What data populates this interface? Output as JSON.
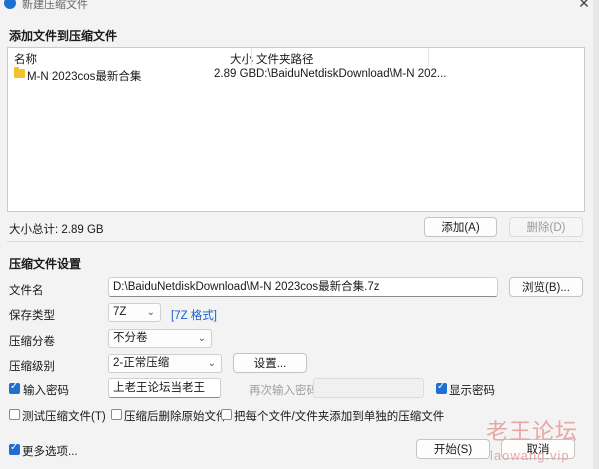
{
  "window": {
    "title": "新建压缩文件"
  },
  "add_section": {
    "title": "添加文件到压缩文件",
    "columns": [
      "名称",
      "大小",
      "文件夹路径"
    ],
    "rows": [
      {
        "name": "M-N 2023cos最新合集",
        "size": "2.89 GB",
        "path": "D:\\BaiduNetdiskDownload\\M-N 202..."
      }
    ],
    "total": "大小总计: 2.89 GB",
    "add_button": "添加(A)",
    "delete_button": "删除(D)"
  },
  "settings": {
    "title": "压缩文件设置",
    "filename_label": "文件名",
    "filename_value": "D:\\BaiduNetdiskDownload\\M-N 2023cos最新合集.7z",
    "browse_button": "浏览(B)...",
    "type_label": "保存类型",
    "type_value": "7Z",
    "type_link": "[7Z 格式]",
    "volume_label": "压缩分卷",
    "volume_value": "不分卷",
    "level_label": "压缩级别",
    "level_value": "2-正常压缩",
    "setup_button": "设置...",
    "password_checkbox": "输入密码",
    "password_value": "上老王论坛当老王",
    "repeat_label": "再次输入密码",
    "show_password": "显示密码",
    "test_archive": "测试压缩文件(T)",
    "delete_source": "压缩后删除原始文件",
    "separate_archives": "把每个文件/文件夹添加到单独的压缩文件"
  },
  "footer": {
    "more_options": "更多选项...",
    "start_button": "开始(S)",
    "cancel_button": "取消"
  },
  "watermark": {
    "cn": "老王论坛",
    "en": "laowang.vip"
  },
  "colors": {
    "accent": "#1e6fd0",
    "link": "#1a5fd6",
    "watermark": "#e8a7a7"
  }
}
